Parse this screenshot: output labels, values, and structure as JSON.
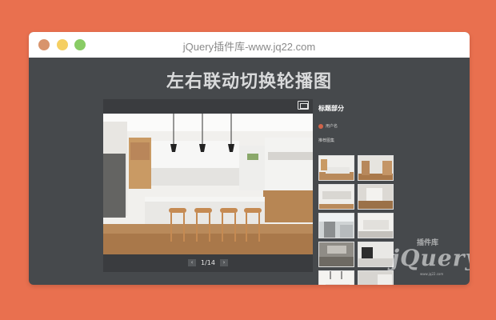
{
  "browser": {
    "title": "jQuery插件库-www.jq22.com",
    "dot_colors": [
      "#d8946c",
      "#f5cf62",
      "#89cc65"
    ]
  },
  "page": {
    "heading": "左右联动切换轮播图"
  },
  "viewer": {
    "fullscreen_icon": "fullscreen-icon",
    "pager": {
      "prev": "‹",
      "current": "1/14",
      "next": "›"
    }
  },
  "sidebar": {
    "title": "标题部分",
    "author": "用户名",
    "section_label": "推荐图集",
    "thumb_count": 10
  },
  "watermark": {
    "line1": "插件库",
    "brand": "jQuery",
    "line2": "www.jq22.com"
  }
}
